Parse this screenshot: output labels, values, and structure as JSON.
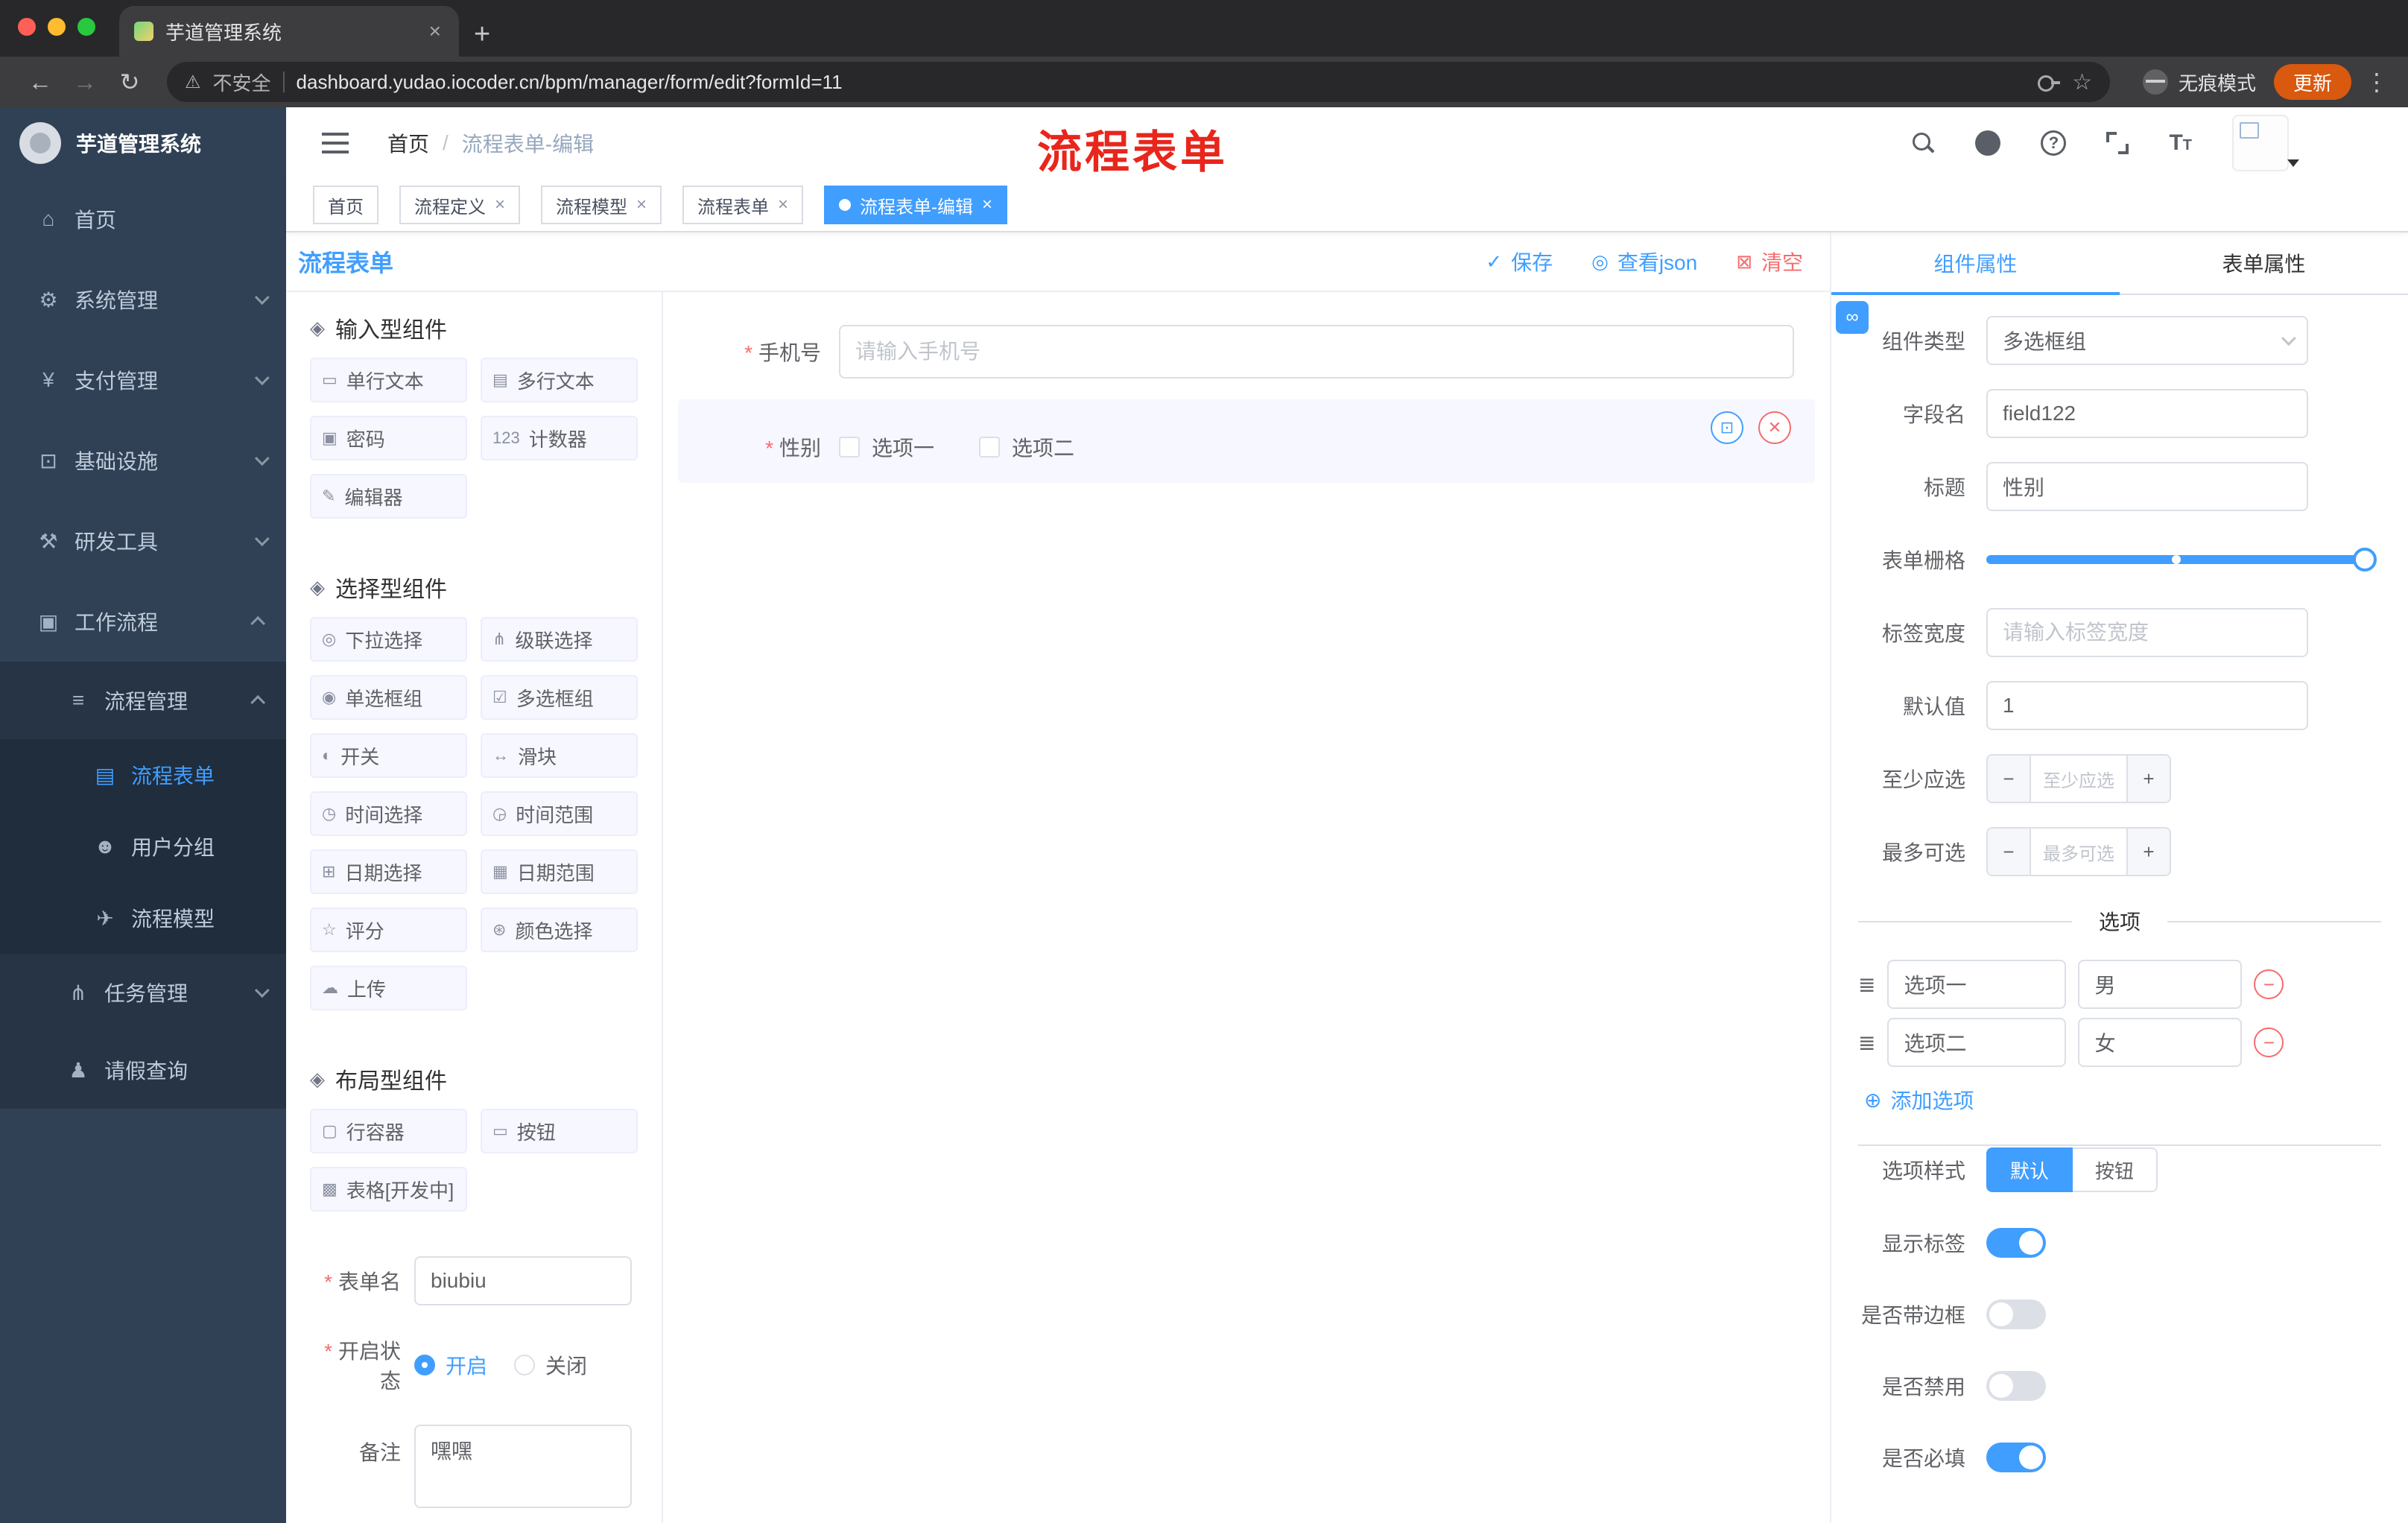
{
  "colors": {
    "primary": "#409eff",
    "danger": "#f56c6c",
    "annotation": "#e8261c",
    "update": "#d9590f",
    "sidebar-bg": "#304156",
    "sidebar-sub": "#263445",
    "sidebar-deep": "#1f2d3d"
  },
  "icons": {
    "back": "←",
    "forward": "→",
    "reload": "↻",
    "warning": "⚠",
    "star": "☆",
    "kebab": "⋮",
    "newtab": "+",
    "close": "×",
    "help": "?",
    "check": "✓",
    "eye": "◎",
    "trash": "⊠",
    "copy": "⊡",
    "delete_x": "✕",
    "minus": "−",
    "plus": "+",
    "add": "⊕",
    "drag": "≣",
    "link": "∞"
  },
  "browser": {
    "tab_title": "芋道管理系统",
    "security_label": "不安全",
    "url": "dashboard.yudao.iocoder.cn/bpm/manager/form/edit?formId=11",
    "incognito_label": "无痕模式",
    "update_label": "更新"
  },
  "sidebar": {
    "title": "芋道管理系统",
    "items": [
      {
        "glyph": "⌂",
        "label": "首页"
      },
      {
        "glyph": "⚙",
        "label": "系统管理"
      },
      {
        "glyph": "¥",
        "label": "支付管理"
      },
      {
        "glyph": "⊡",
        "label": "基础设施"
      },
      {
        "glyph": "⚒",
        "label": "研发工具"
      },
      {
        "glyph": "▣",
        "label": "工作流程"
      },
      {
        "glyph": "≡",
        "label": "流程管理"
      },
      {
        "glyph": "▤",
        "label": "流程表单"
      },
      {
        "glyph": "☻",
        "label": "用户分组"
      },
      {
        "glyph": "✈",
        "label": "流程模型"
      },
      {
        "glyph": "⋔",
        "label": "任务管理"
      },
      {
        "glyph": "♟",
        "label": "请假查询"
      }
    ]
  },
  "header": {
    "breadcrumb_home": "首页",
    "breadcrumb_sep": "/",
    "breadcrumb_current": "流程表单-编辑",
    "annotation": "流程表单"
  },
  "tags": [
    {
      "label": "首页"
    },
    {
      "label": "流程定义"
    },
    {
      "label": "流程模型"
    },
    {
      "label": "流程表单"
    },
    {
      "label": "流程表单-编辑"
    }
  ],
  "panel": {
    "title": "流程表单",
    "actions": {
      "save": "保存",
      "view_json": "查看json",
      "clear": "清空"
    }
  },
  "palette": {
    "sections": [
      {
        "icon": "◈",
        "label": "输入型组件",
        "items": [
          {
            "icon": "▭",
            "label": "单行文本"
          },
          {
            "icon": "▤",
            "label": "多行文本"
          },
          {
            "icon": "▣",
            "label": "密码"
          },
          {
            "icon": "123",
            "label": "计数器"
          },
          {
            "icon": "✎",
            "label": "编辑器"
          }
        ]
      },
      {
        "icon": "◈",
        "label": "选择型组件",
        "items": [
          {
            "icon": "◎",
            "label": "下拉选择"
          },
          {
            "icon": "⋔",
            "label": "级联选择"
          },
          {
            "icon": "◉",
            "label": "单选框组"
          },
          {
            "icon": "☑",
            "label": "多选框组"
          },
          {
            "icon": "◐",
            "label": "开关"
          },
          {
            "icon": "↔",
            "label": "滑块"
          },
          {
            "icon": "◷",
            "label": "时间选择"
          },
          {
            "icon": "◶",
            "label": "时间范围"
          },
          {
            "icon": "⊞",
            "label": "日期选择"
          },
          {
            "icon": "▦",
            "label": "日期范围"
          },
          {
            "icon": "☆",
            "label": "评分"
          },
          {
            "icon": "⊛",
            "label": "颜色选择"
          },
          {
            "icon": "☁",
            "label": "上传"
          }
        ]
      },
      {
        "icon": "◈",
        "label": "布局型组件",
        "items": [
          {
            "icon": "▢",
            "label": "行容器"
          },
          {
            "icon": "▭",
            "label": "按钮"
          },
          {
            "icon": "▩",
            "label": "表格[开发中]"
          }
        ]
      }
    ]
  },
  "form_config": {
    "name": {
      "label": "表单名",
      "value": "biubiu"
    },
    "status": {
      "label": "开启状态",
      "options": [
        "开启",
        "关闭"
      ],
      "selected": "开启"
    },
    "remark": {
      "label": "备注",
      "value": "嘿嘿"
    }
  },
  "canvas": {
    "phone": {
      "label": "手机号",
      "placeholder": "请输入手机号"
    },
    "gender": {
      "label": "性别",
      "options": [
        "选项一",
        "选项二"
      ]
    }
  },
  "inspector": {
    "tab_component": "组件属性",
    "tab_form": "表单属性",
    "rows": {
      "type": {
        "label": "组件类型",
        "value": "多选框组"
      },
      "field": {
        "label": "字段名",
        "value": "field122"
      },
      "title": {
        "label": "标题",
        "value": "性别"
      },
      "grid": {
        "label": "表单栅格"
      },
      "label_width": {
        "label": "标签宽度",
        "placeholder": "请输入标签宽度"
      },
      "default": {
        "label": "默认值",
        "value": "1"
      },
      "min": {
        "label": "至少应选",
        "placeholder": "至少应选"
      },
      "max": {
        "label": "最多可选",
        "placeholder": "最多可选"
      }
    },
    "options_title": "选项",
    "options": [
      {
        "label": "选项一",
        "value": "男"
      },
      {
        "label": "选项二",
        "value": "女"
      }
    ],
    "add_option": "添加选项",
    "style": {
      "label": "选项样式",
      "options": [
        "默认",
        "按钮"
      ],
      "selected": "默认"
    },
    "switches": [
      {
        "label": "显示标签",
        "on": true
      },
      {
        "label": "是否带边框",
        "on": false
      },
      {
        "label": "是否禁用",
        "on": false
      },
      {
        "label": "是否必填",
        "on": true
      }
    ]
  }
}
